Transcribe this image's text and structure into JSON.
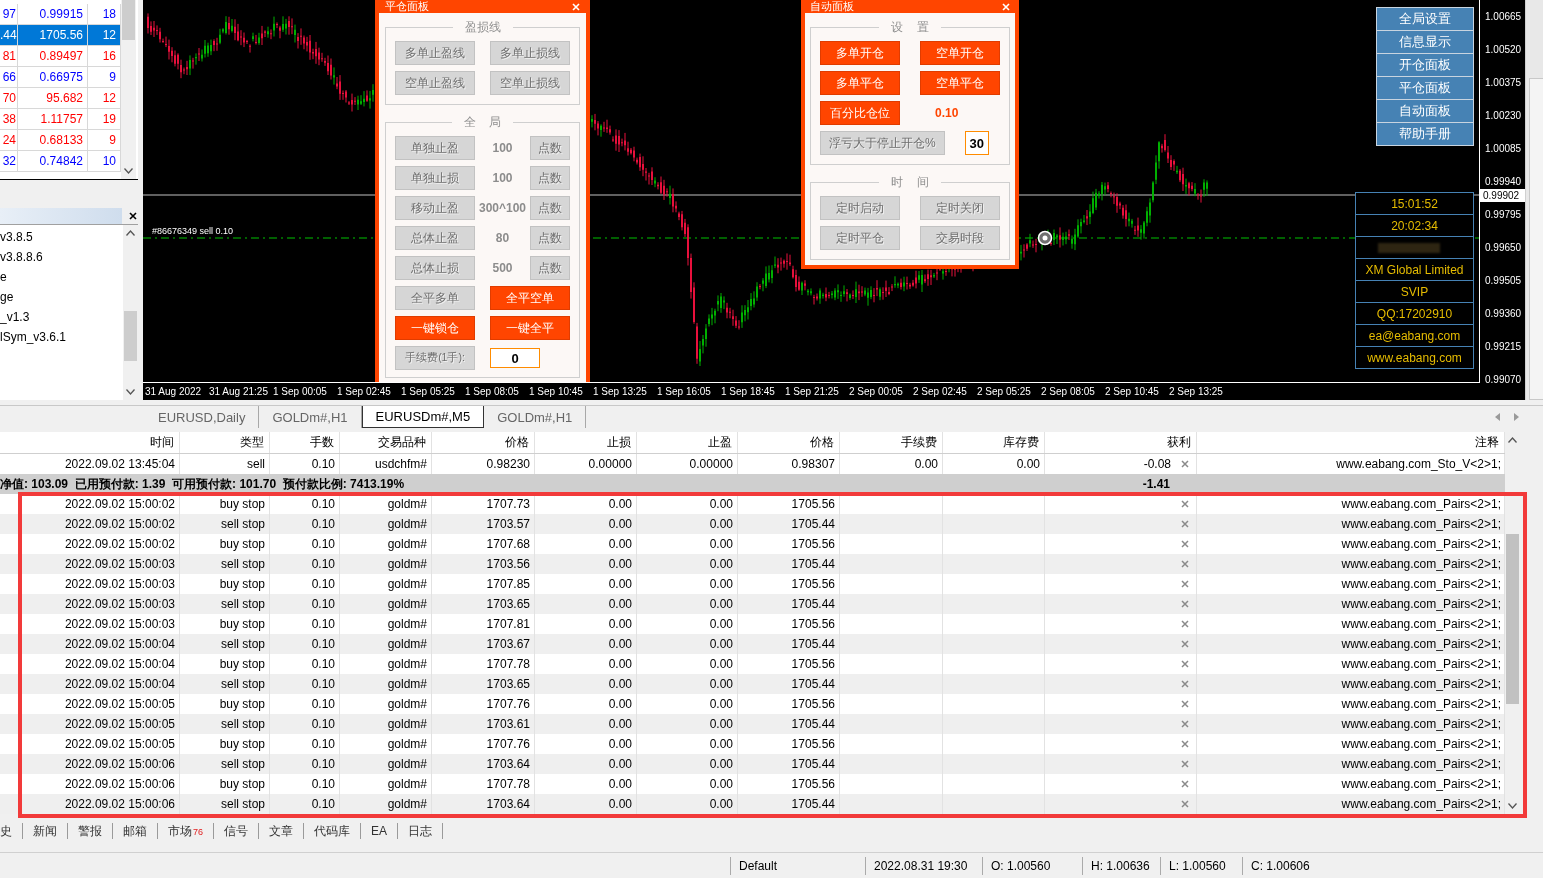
{
  "market_watch": {
    "rows": [
      {
        "bid": "97",
        "ask": "0.99915",
        "spread": "18",
        "color": "#0000ff",
        "selected": false
      },
      {
        "bid": ".44",
        "ask": "1705.56",
        "spread": "12",
        "selected": true
      },
      {
        "bid": "81",
        "ask": "0.89497",
        "spread": "16",
        "color": "#ff0000",
        "selected": false
      },
      {
        "bid": "66",
        "ask": "0.66975",
        "spread": "9",
        "color": "#0000ff",
        "selected": false
      },
      {
        "bid": "70",
        "ask": "95.682",
        "spread": "12",
        "color": "#ff0000",
        "selected": false
      },
      {
        "bid": "38",
        "ask": "1.11757",
        "spread": "19",
        "color": "#ff0000",
        "selected": false
      },
      {
        "bid": "24",
        "ask": "0.68133",
        "spread": "9",
        "color": "#ff0000",
        "selected": false
      },
      {
        "bid": "32",
        "ask": "0.74842",
        "spread": "10",
        "color": "#0000ff",
        "selected": false
      }
    ]
  },
  "navigator": {
    "items": [
      "v3.8.5",
      "v3.8.8.6",
      "e",
      "ge",
      "_v1.3",
      "lSym_v3.6.1"
    ]
  },
  "chart": {
    "order_label": "#86676349 sell 0.10",
    "current_price": "0.99902",
    "price_labels": [
      "1.00665",
      "1.00520",
      "1.00375",
      "1.00230",
      "1.00085",
      "0.99940",
      "0.99795",
      "0.99650",
      "0.99505",
      "0.99360",
      "0.99215",
      "0.99070"
    ],
    "time_labels": [
      "31 Aug 2022",
      "31 Aug 21:25",
      "1 Sep 00:05",
      "1 Sep 02:45",
      "1 Sep 05:25",
      "1 Sep 08:05",
      "1 Sep 10:45",
      "1 Sep 13:25",
      "1 Sep 16:05",
      "1 Sep 18:45",
      "1 Sep 21:25",
      "2 Sep 00:05",
      "2 Sep 02:45",
      "2 Sep 05:25",
      "2 Sep 08:05",
      "2 Sep 10:45",
      "2 Sep 13:25"
    ],
    "close_panel": {
      "title": "平仓面板",
      "sections": [
        {
          "title": "盈损线",
          "rows": [
            [
              {
                "kind": "button",
                "label": "多单止盈线",
                "on": false
              },
              {
                "kind": "button",
                "label": "多单止损线",
                "on": false
              }
            ],
            [
              {
                "kind": "button",
                "label": "空单止盈线",
                "on": false
              },
              {
                "kind": "button",
                "label": "空单止损线",
                "on": false
              }
            ]
          ]
        },
        {
          "title": "全 局",
          "rows": [
            [
              {
                "kind": "button",
                "label": "单独止盈",
                "on": false
              },
              {
                "kind": "value",
                "text": "100",
                "on": false
              },
              {
                "kind": "small_button",
                "label": "点数",
                "on": false
              }
            ],
            [
              {
                "kind": "button",
                "label": "单独止损",
                "on": false
              },
              {
                "kind": "value",
                "text": "100",
                "on": false
              },
              {
                "kind": "small_button",
                "label": "点数",
                "on": false
              }
            ],
            [
              {
                "kind": "button",
                "label": "移动止盈",
                "on": false
              },
              {
                "kind": "value",
                "text": "300^100",
                "on": false
              },
              {
                "kind": "small_button",
                "label": "点数",
                "on": false
              }
            ],
            [
              {
                "kind": "button",
                "label": "总体止盈",
                "on": false
              },
              {
                "kind": "value",
                "text": "80",
                "on": false
              },
              {
                "kind": "small_button",
                "label": "点数",
                "on": false
              }
            ],
            [
              {
                "kind": "button",
                "label": "总体止损",
                "on": false
              },
              {
                "kind": "value",
                "text": "500",
                "on": false
              },
              {
                "kind": "small_button",
                "label": "点数",
                "on": false
              }
            ],
            [
              {
                "kind": "button",
                "label": "全平多单",
                "on": false
              },
              {
                "kind": "button",
                "label": "全平空单",
                "on": true
              }
            ],
            [
              {
                "kind": "button",
                "label": "一键锁仓",
                "on": true
              },
              {
                "kind": "button",
                "label": "一键全平",
                "on": true
              }
            ],
            [
              {
                "kind": "label",
                "text": "手续费(1手):"
              },
              {
                "kind": "input",
                "value": "0"
              }
            ]
          ]
        }
      ]
    },
    "auto_panel": {
      "title": "自动面板",
      "sections": [
        {
          "title": "设 置",
          "rows": [
            [
              {
                "kind": "button",
                "label": "多单开仓",
                "on": true
              },
              {
                "kind": "button",
                "label": "空单开仓",
                "on": true
              }
            ],
            [
              {
                "kind": "button",
                "label": "多单平仓",
                "on": true
              },
              {
                "kind": "button",
                "label": "空单平仓",
                "on": true
              }
            ],
            [
              {
                "kind": "button",
                "label": "百分比仓位",
                "on": true
              },
              {
                "kind": "value",
                "text": "0.10",
                "on": true
              }
            ],
            [
              {
                "kind": "button",
                "label": "浮亏大于停止开仓%",
                "on": false
              },
              {
                "kind": "input",
                "value": "30"
              }
            ]
          ]
        },
        {
          "title": "时 间",
          "rows": [
            [
              {
                "kind": "button",
                "label": "定时启动",
                "on": false
              },
              {
                "kind": "button",
                "label": "定时关闭",
                "on": false
              }
            ],
            [
              {
                "kind": "button",
                "label": "定时平仓",
                "on": false
              },
              {
                "kind": "button",
                "label": "交易时段",
                "on": false
              }
            ]
          ]
        }
      ]
    },
    "menu_buttons": [
      "全局设置",
      "信息显示",
      "开仓面板",
      "平仓面板",
      "自动面板",
      "帮助手册"
    ],
    "info_rows": [
      {
        "kind": "text",
        "text": "15:01:52"
      },
      {
        "kind": "text",
        "text": "20:02:34"
      },
      {
        "kind": "redacted"
      },
      {
        "kind": "text",
        "text": "XM Global Limited"
      },
      {
        "kind": "text",
        "text": "SVIP"
      },
      {
        "kind": "text",
        "text": "QQ:17202910"
      },
      {
        "kind": "text",
        "text": "ea@eabang.com"
      },
      {
        "kind": "text",
        "text": "www.eabang.com"
      }
    ]
  },
  "chart_tabs": [
    {
      "label": "EURUSD,Daily",
      "selected": false
    },
    {
      "label": "GOLDm#,H1",
      "selected": false
    },
    {
      "label": "EURUSDm#,M5",
      "selected": true
    },
    {
      "label": "GOLDm#,H1",
      "selected": false
    }
  ],
  "terminal": {
    "columns": [
      "时间",
      "类型",
      "手数",
      "交易品种",
      "价格",
      "止损",
      "止盈",
      "价格",
      "手续费",
      "库存费",
      "获利",
      "注释"
    ],
    "positions": [
      {
        "time": "2022.09.02 13:45:04",
        "type": "sell",
        "lots": "0.10",
        "symbol": "usdchfm#",
        "price": "0.98230",
        "sl": "0.00000",
        "tp": "0.00000",
        "current": "0.98307",
        "commission": "0.00",
        "swap": "0.00",
        "profit": "-0.08",
        "comment": "www.eabang.com_Sto_V<2>1;"
      }
    ],
    "summary": {
      "text": "净值: 103.09  已用预付款: 1.39  可用预付款: 101.70  预付款比例: 7413.19%",
      "profit": "-1.41"
    },
    "orders": [
      {
        "time": "2022.09.02 15:00:02",
        "type": "buy stop",
        "lots": "0.10",
        "symbol": "goldm#",
        "price": "1707.73",
        "sl": "0.00",
        "tp": "0.00",
        "current": "1705.56",
        "comment": "www.eabang.com_Pairs<2>1;"
      },
      {
        "time": "2022.09.02 15:00:02",
        "type": "sell stop",
        "lots": "0.10",
        "symbol": "goldm#",
        "price": "1703.57",
        "sl": "0.00",
        "tp": "0.00",
        "current": "1705.44",
        "comment": "www.eabang.com_Pairs<2>1;"
      },
      {
        "time": "2022.09.02 15:00:02",
        "type": "buy stop",
        "lots": "0.10",
        "symbol": "goldm#",
        "price": "1707.68",
        "sl": "0.00",
        "tp": "0.00",
        "current": "1705.56",
        "comment": "www.eabang.com_Pairs<2>1;"
      },
      {
        "time": "2022.09.02 15:00:03",
        "type": "sell stop",
        "lots": "0.10",
        "symbol": "goldm#",
        "price": "1703.56",
        "sl": "0.00",
        "tp": "0.00",
        "current": "1705.44",
        "comment": "www.eabang.com_Pairs<2>1;"
      },
      {
        "time": "2022.09.02 15:00:03",
        "type": "buy stop",
        "lots": "0.10",
        "symbol": "goldm#",
        "price": "1707.85",
        "sl": "0.00",
        "tp": "0.00",
        "current": "1705.56",
        "comment": "www.eabang.com_Pairs<2>1;"
      },
      {
        "time": "2022.09.02 15:00:03",
        "type": "sell stop",
        "lots": "0.10",
        "symbol": "goldm#",
        "price": "1703.65",
        "sl": "0.00",
        "tp": "0.00",
        "current": "1705.44",
        "comment": "www.eabang.com_Pairs<2>1;"
      },
      {
        "time": "2022.09.02 15:00:03",
        "type": "buy stop",
        "lots": "0.10",
        "symbol": "goldm#",
        "price": "1707.81",
        "sl": "0.00",
        "tp": "0.00",
        "current": "1705.56",
        "comment": "www.eabang.com_Pairs<2>1;"
      },
      {
        "time": "2022.09.02 15:00:04",
        "type": "sell stop",
        "lots": "0.10",
        "symbol": "goldm#",
        "price": "1703.67",
        "sl": "0.00",
        "tp": "0.00",
        "current": "1705.44",
        "comment": "www.eabang.com_Pairs<2>1;"
      },
      {
        "time": "2022.09.02 15:00:04",
        "type": "buy stop",
        "lots": "0.10",
        "symbol": "goldm#",
        "price": "1707.78",
        "sl": "0.00",
        "tp": "0.00",
        "current": "1705.56",
        "comment": "www.eabang.com_Pairs<2>1;"
      },
      {
        "time": "2022.09.02 15:00:04",
        "type": "sell stop",
        "lots": "0.10",
        "symbol": "goldm#",
        "price": "1703.65",
        "sl": "0.00",
        "tp": "0.00",
        "current": "1705.44",
        "comment": "www.eabang.com_Pairs<2>1;"
      },
      {
        "time": "2022.09.02 15:00:05",
        "type": "buy stop",
        "lots": "0.10",
        "symbol": "goldm#",
        "price": "1707.76",
        "sl": "0.00",
        "tp": "0.00",
        "current": "1705.56",
        "comment": "www.eabang.com_Pairs<2>1;"
      },
      {
        "time": "2022.09.02 15:00:05",
        "type": "sell stop",
        "lots": "0.10",
        "symbol": "goldm#",
        "price": "1703.61",
        "sl": "0.00",
        "tp": "0.00",
        "current": "1705.44",
        "comment": "www.eabang.com_Pairs<2>1;"
      },
      {
        "time": "2022.09.02 15:00:05",
        "type": "buy stop",
        "lots": "0.10",
        "symbol": "goldm#",
        "price": "1707.76",
        "sl": "0.00",
        "tp": "0.00",
        "current": "1705.56",
        "comment": "www.eabang.com_Pairs<2>1;"
      },
      {
        "time": "2022.09.02 15:00:06",
        "type": "sell stop",
        "lots": "0.10",
        "symbol": "goldm#",
        "price": "1703.64",
        "sl": "0.00",
        "tp": "0.00",
        "current": "1705.44",
        "comment": "www.eabang.com_Pairs<2>1;"
      },
      {
        "time": "2022.09.02 15:00:06",
        "type": "buy stop",
        "lots": "0.10",
        "symbol": "goldm#",
        "price": "1707.78",
        "sl": "0.00",
        "tp": "0.00",
        "current": "1705.56",
        "comment": "www.eabang.com_Pairs<2>1;"
      },
      {
        "time": "2022.09.02 15:00:06",
        "type": "sell stop",
        "lots": "0.10",
        "symbol": "goldm#",
        "price": "1703.64",
        "sl": "0.00",
        "tp": "0.00",
        "current": "1705.44",
        "comment": "www.eabang.com_Pairs<2>1;"
      }
    ],
    "tabs": [
      {
        "label": "史",
        "selected": false
      },
      {
        "label": "新闻",
        "selected": false
      },
      {
        "label": "警报",
        "selected": false
      },
      {
        "label": "邮箱",
        "selected": false
      },
      {
        "label": "市场",
        "badge": "76",
        "selected": false
      },
      {
        "label": "信号",
        "selected": false
      },
      {
        "label": "文章",
        "selected": false
      },
      {
        "label": "代码库",
        "selected": false
      },
      {
        "label": "EA",
        "selected": false
      },
      {
        "label": "日志",
        "selected": false
      }
    ]
  },
  "status_bar": [
    "Default",
    "2022.08.31 19:30",
    "O: 1.00560",
    "H: 1.00636",
    "L: 1.00560",
    "C: 1.00606"
  ]
}
